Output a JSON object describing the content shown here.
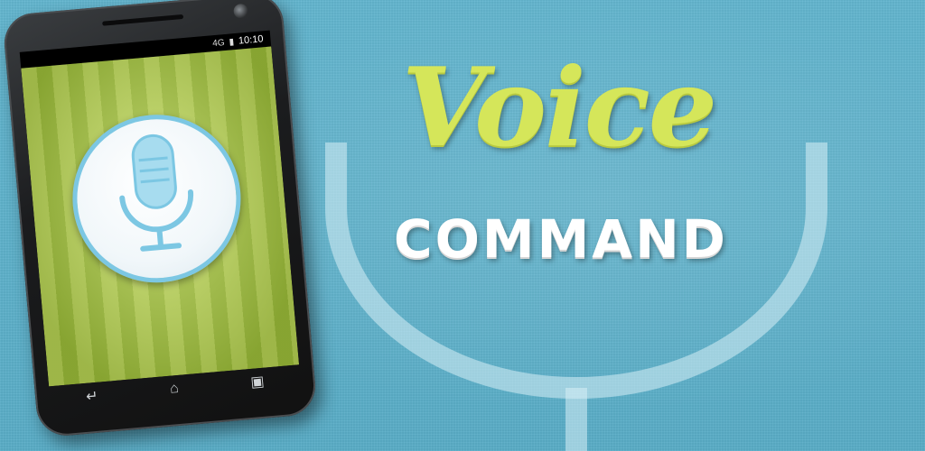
{
  "title": {
    "voice": "Voice",
    "command": "COMMAND"
  },
  "phone": {
    "status_time": "10:10",
    "status_signal": "4G"
  },
  "icons": {
    "camera": "camera-icon",
    "microphone": "microphone-icon",
    "back": "back-arrow-icon",
    "home": "home-icon",
    "recent": "recent-apps-icon",
    "battery": "battery-icon",
    "signal": "signal-icon"
  },
  "colors": {
    "background": "#5fb2cc",
    "title_voice": "#d5e65a",
    "title_command": "#ffffff",
    "stripe_light": "#b9d655",
    "stripe_dark": "#9fc13a",
    "mic_ring": "#7cc7e3"
  }
}
